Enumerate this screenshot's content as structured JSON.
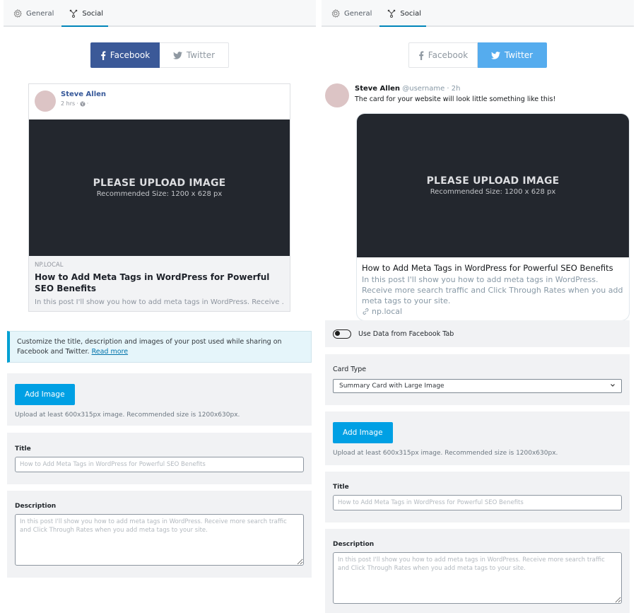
{
  "tabs": [
    {
      "label": "General",
      "icon": "gear-icon"
    },
    {
      "label": "Social",
      "icon": "share-network-icon",
      "active": true
    }
  ],
  "networks": {
    "facebook_label": "Facebook",
    "twitter_label": "Twitter"
  },
  "colors": {
    "facebook": "#3b5998",
    "twitter": "#55acee",
    "accent": "#0085ba",
    "button": "#00a0e4",
    "placeholder_bg": "#23272e"
  },
  "facebook_preview": {
    "author": "Steve Allen",
    "time": "2 hrs",
    "separator": "·",
    "image_title": "PLEASE UPLOAD IMAGE",
    "image_subtitle": "Recommended Size: 1200 x 628 px",
    "domain": "NP.LOCAL",
    "title": "How to Add Meta Tags in WordPress for Powerful SEO Benefits",
    "description": "In this post I'll show you how to add meta tags in WordPress. Receive ..."
  },
  "twitter_preview": {
    "author": "Steve Allen",
    "handle": "@username",
    "time": "· 2h",
    "tweet_text": "The card for your website will look little something like this!",
    "image_title": "PLEASE UPLOAD IMAGE",
    "image_subtitle": "Recommended Size: 1200 x 628 px",
    "title": "How to Add Meta Tags in WordPress for Powerful SEO Benefits",
    "description": "In this post I'll show you how to add meta tags in WordPress. Receive more search traffic and Click Through Rates when you add meta tags to your site.",
    "domain": "np.local"
  },
  "notice": {
    "text": "Customize the title, description and images of your post used while sharing on Facebook and Twitter. ",
    "link": "Read more"
  },
  "form": {
    "add_image_label": "Add Image",
    "upload_hint": "Upload at least 600x315px image. Recommended size is 1200x630px.",
    "title_label": "Title",
    "title_placeholder": "How to Add Meta Tags in WordPress for Powerful SEO Benefits",
    "description_label": "Description",
    "description_placeholder": "In this post I'll show you how to add meta tags in WordPress. Receive more search traffic and Click Through Rates when you add meta tags to your site.",
    "use_facebook_label": "Use Data from Facebook Tab",
    "use_facebook_enabled": false,
    "card_type_label": "Card Type",
    "card_type_value": "Summary Card with Large Image"
  }
}
